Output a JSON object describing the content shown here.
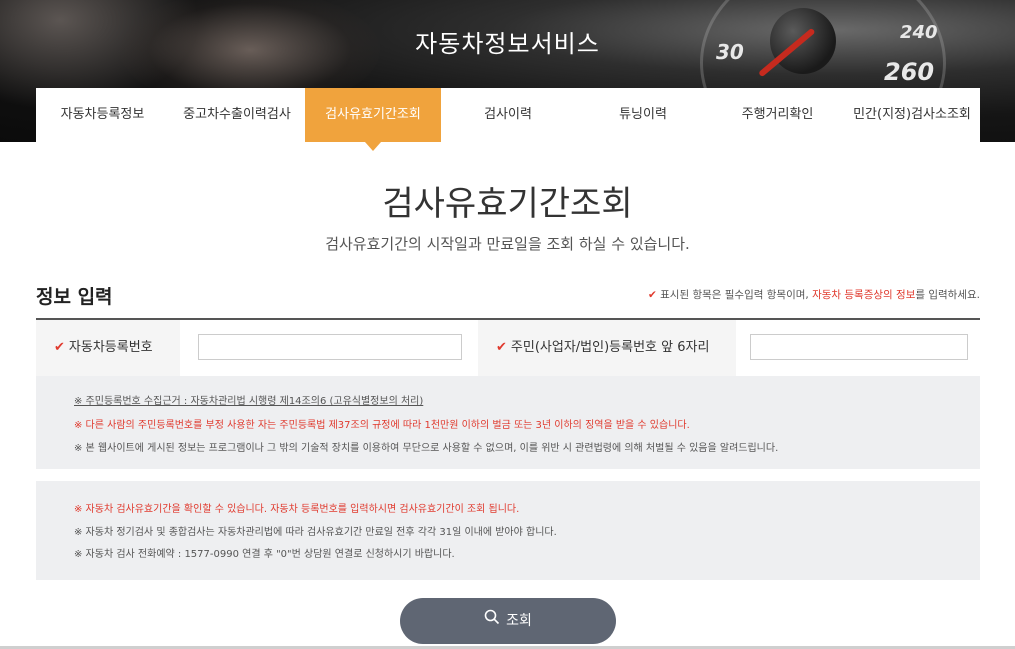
{
  "site": {
    "title": "자동차정보서비스"
  },
  "banner": {
    "gauge_numbers": [
      "30",
      "240",
      "260"
    ]
  },
  "nav": {
    "items": [
      {
        "label": "자동차등록정보",
        "active": false
      },
      {
        "label": "중고차수출이력검사",
        "active": false
      },
      {
        "label": "검사유효기간조회",
        "active": true
      },
      {
        "label": "검사이력",
        "active": false
      },
      {
        "label": "튜닝이력",
        "active": false
      },
      {
        "label": "주행거리확인",
        "active": false
      },
      {
        "label": "민간(지정)검사소조회",
        "active": false
      }
    ]
  },
  "page": {
    "title": "검사유효기간조회",
    "subtitle": "검사유효기간의 시작일과 만료일을 조회 하실 수 있습니다."
  },
  "section": {
    "title": "정보 입력",
    "required_note_prefix": "표시된 항목은 필수입력 항목이며, ",
    "required_note_highlight": "자동차 등록증상의 정보",
    "required_note_suffix": "를 입력하세요."
  },
  "form": {
    "vehicle_label": "자동차등록번호",
    "vehicle_value": "",
    "id_label": "주민(사업자/법인)등록번호 앞 6자리",
    "id_value": ""
  },
  "notice1": {
    "line1": "※ 주민등록번호 수집근거 : 자동차관리법 시행령 제14조의6 (고유식별정보의 처리)",
    "line2": "※ 다른 사람의 주민등록번호를 부정 사용한 자는 주민등록법 제37조의 규정에 따라 1천만원 이하의 벌금 또는 3년 이하의 징역을 받을 수 있습니다.",
    "line3": "※ 본 웹사이트에 게시된 정보는 프로그램이나 그 밖의 기술적 장치를 이용하여 무단으로 사용할 수 없으며, 이를 위반 시 관련법령에 의해 처벌될 수 있음을 알려드립니다."
  },
  "notice2": {
    "line1": "※ 자동차 검사유효기간을 확인할 수 있습니다. 자동차 등록번호를 입력하시면 검사유효기간이 조회 됩니다.",
    "line2": "※ 자동차 정기검사 및 종합검사는 자동차관리법에 따라 검사유효기간 만료일 전후 각각 31일 이내에 받아야 합니다.",
    "line3": "※ 자동차 검사 전화예약 : 1577-0990 연결 후 \"0\"번 상담원 연결로 신청하시기 바랍니다."
  },
  "search": {
    "label": "조회"
  },
  "colors": {
    "accent": "#f0a33d",
    "warning": "#e03a2e",
    "button": "#5f6673"
  }
}
